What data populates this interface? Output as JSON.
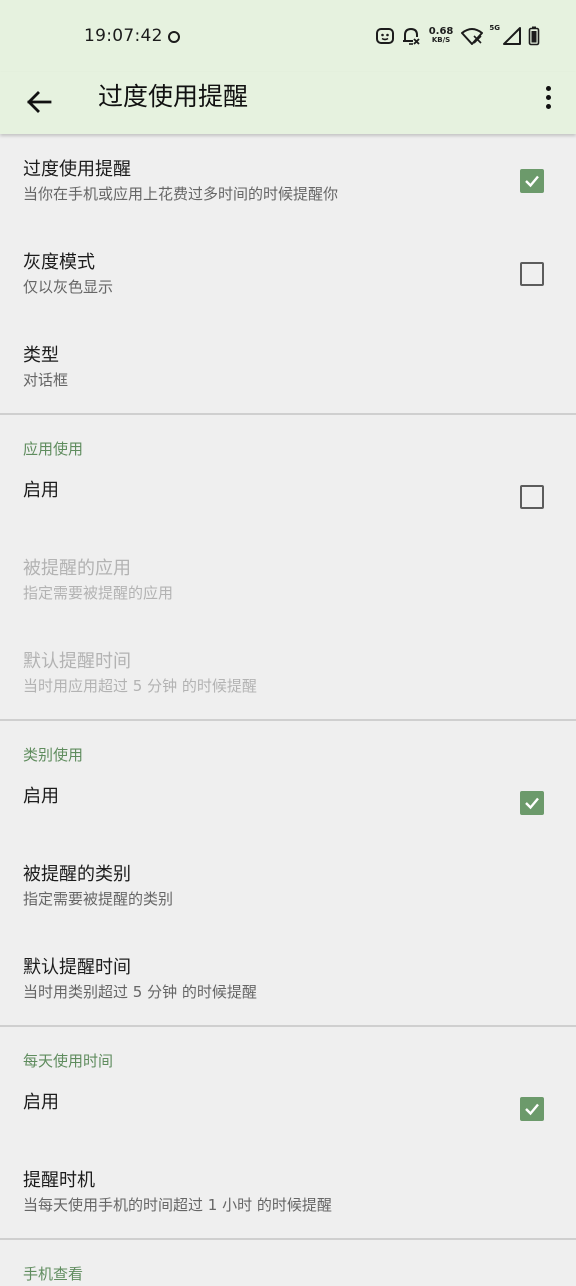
{
  "status_bar": {
    "time": "19:07:42",
    "net_speed_value": "0.68",
    "net_speed_unit": "KB/S",
    "signal_label": "5G"
  },
  "app_bar": {
    "title": "过度使用提醒",
    "back_icon": "arrow-left-icon",
    "more_icon": "more-vert-icon"
  },
  "colors": {
    "app_bar_bg": "#e6f2df",
    "accent": "#6c9a6b",
    "category_text": "#5f8c5e",
    "background": "#efefef"
  },
  "general": {
    "overuse": {
      "title": "过度使用提醒",
      "summary": "当你在手机或应用上花费过多时间的时候提醒你",
      "checked": true
    },
    "grayscale": {
      "title": "灰度模式",
      "summary": "仅以灰色显示",
      "checked": false
    },
    "type": {
      "title": "类型",
      "summary": "对话框"
    }
  },
  "app_usage": {
    "header": "应用使用",
    "enable": {
      "title": "启用",
      "checked": false
    },
    "apps": {
      "title": "被提醒的应用",
      "summary": "指定需要被提醒的应用"
    },
    "default_time": {
      "title": "默认提醒时间",
      "summary": "当时用应用超过 5 分钟 的时候提醒"
    }
  },
  "category_usage": {
    "header": "类别使用",
    "enable": {
      "title": "启用",
      "checked": true
    },
    "categories": {
      "title": "被提醒的类别",
      "summary": "指定需要被提醒的类别"
    },
    "default_time": {
      "title": "默认提醒时间",
      "summary": "当时用类别超过 5 分钟 的时候提醒"
    }
  },
  "daily_usage": {
    "header": "每天使用时间",
    "enable": {
      "title": "启用",
      "checked": true
    },
    "timing": {
      "title": "提醒时机",
      "summary": "当每天使用手机的时间超过 1 小时 的时候提醒"
    }
  },
  "phone_check": {
    "header": "手机查看"
  }
}
